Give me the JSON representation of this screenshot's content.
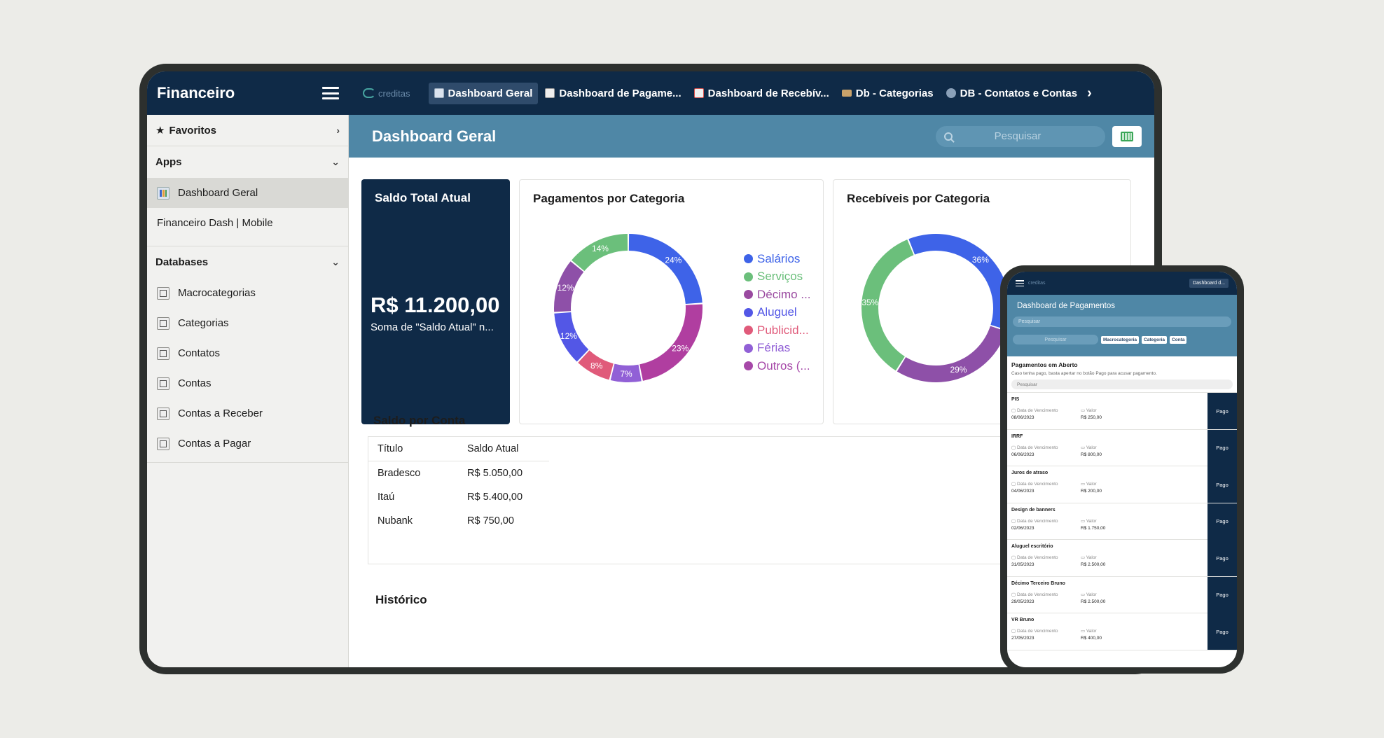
{
  "tablet": {
    "brand": "Financeiro",
    "app_logo": "creditas",
    "tabs": [
      {
        "label": "Dashboard Geral",
        "active": true,
        "color": "#3c66c9"
      },
      {
        "label": "Dashboard de Pagame...",
        "active": false,
        "color": "#e6e6e6"
      },
      {
        "label": "Dashboard de Recebív...",
        "active": false,
        "color": "#d9534f"
      },
      {
        "label": "Db - Categorias",
        "active": false,
        "color": "#8a6d3b"
      },
      {
        "label": "DB - Contatos e Contas",
        "active": false,
        "color": "#9ab"
      }
    ],
    "sidebar": {
      "favoritos": "Favoritos",
      "apps_label": "Apps",
      "apps": [
        "Dashboard Geral",
        "Financeiro Dash | Mobile"
      ],
      "databases_label": "Databases",
      "databases": [
        "Macrocategorias",
        "Categorias",
        "Contatos",
        "Contas",
        "Contas a Receber",
        "Contas a Pagar"
      ]
    },
    "page_title": "Dashboard Geral",
    "search_placeholder": "Pesquisar",
    "saldo": {
      "title": "Saldo Total Atual",
      "value": "R$ 11.200,00",
      "subtitle": "Soma de \"Saldo Atual\" n..."
    },
    "saldo_conta": {
      "title": "Saldo por Conta",
      "headers": [
        "Título",
        "Saldo Atual"
      ],
      "rows": [
        [
          "Bradesco",
          "R$ 5.050,00"
        ],
        [
          "Itaú",
          "R$ 5.400,00"
        ],
        [
          "Nubank",
          "R$ 750,00"
        ]
      ]
    },
    "historico_title": "Histórico"
  },
  "chart_data": [
    {
      "type": "pie",
      "title": "Pagamentos por Categoria",
      "slices": [
        {
          "name": "Salários",
          "value": 24,
          "color": "#3e63e8"
        },
        {
          "name": "Décimo ...",
          "value": 23,
          "color": "#b03ea0"
        },
        {
          "name": "Férias",
          "value": 7,
          "color": "#9160d6"
        },
        {
          "name": "Publicid...",
          "value": 8,
          "color": "#e05a7a"
        },
        {
          "name": "Aluguel",
          "value": 12,
          "color": "#5357e6"
        },
        {
          "name": "Outros (...",
          "value": 12,
          "color": "#8e50a8"
        },
        {
          "name": "Serviços",
          "value": 14,
          "color": "#6bbf7b"
        }
      ],
      "legend": [
        {
          "name": "Salários",
          "color": "#3e63e8"
        },
        {
          "name": "Serviços",
          "color": "#6bbf7b"
        },
        {
          "name": "Décimo ...",
          "color": "#9a4aa0"
        },
        {
          "name": "Aluguel",
          "color": "#5357e6"
        },
        {
          "name": "Publicid...",
          "color": "#e05a7a"
        },
        {
          "name": "Férias",
          "color": "#9160d6"
        },
        {
          "name": "Outros (...",
          "color": "#a648a8"
        }
      ],
      "legend_position": "right"
    },
    {
      "type": "pie",
      "title": "Recebíveis por Categoria",
      "slices": [
        {
          "name": "",
          "value": 36,
          "color": "#3e63e8"
        },
        {
          "name": "",
          "value": 29,
          "color": "#8e50a8"
        },
        {
          "name": "",
          "value": 35,
          "color": "#6bbf7b"
        }
      ]
    }
  ],
  "phone": {
    "logo": "creditas",
    "tab": "Dashboard d...",
    "title": "Dashboard de Pagamentos",
    "search_placeholder": "Pesquisar",
    "filter_search": "Pesquisar",
    "filters": [
      "Macrocategoria",
      "Categoria",
      "Conta"
    ],
    "open_title": "Pagamentos em Aberto",
    "open_desc": "Caso tenha pago, basta apertar no botão Pago para acusar pagamento.",
    "open_search": "Pesquisar",
    "date_label": "Data de Vencimento",
    "value_label": "Valor",
    "pay_label": "Pago",
    "items": [
      {
        "name": "PIS",
        "date": "08/06/2023",
        "value": "R$ 250,00"
      },
      {
        "name": "IRRF",
        "date": "06/06/2023",
        "value": "R$ 800,00"
      },
      {
        "name": "Juros de atraso",
        "date": "04/06/2023",
        "value": "R$ 200,00"
      },
      {
        "name": "Design de banners",
        "date": "02/06/2023",
        "value": "R$ 1.750,00"
      },
      {
        "name": "Aluguel escritório",
        "date": "31/05/2023",
        "value": "R$ 2.500,00"
      },
      {
        "name": "Décimo Terceiro Bruno",
        "date": "29/05/2023",
        "value": "R$ 2.500,00"
      },
      {
        "name": "VR Bruno",
        "date": "27/05/2023",
        "value": "R$ 400,00"
      }
    ]
  }
}
